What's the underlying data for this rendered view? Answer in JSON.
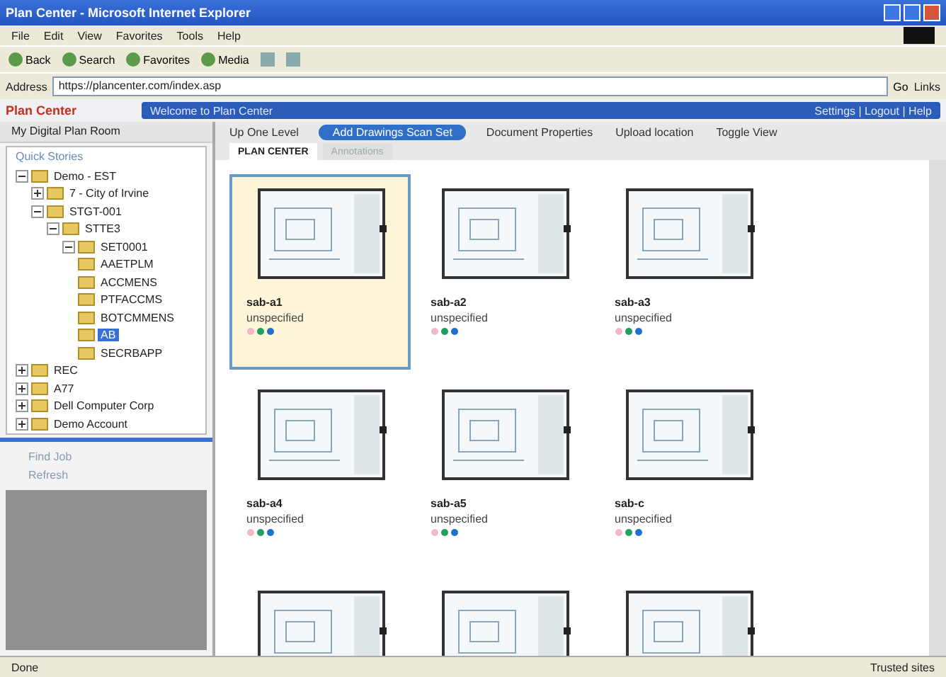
{
  "window": {
    "title": "Plan Center - Microsoft Internet Explorer"
  },
  "menu": [
    "File",
    "Edit",
    "View",
    "Favorites",
    "Tools",
    "Help"
  ],
  "toolbar": [
    {
      "label": "Back"
    },
    {
      "label": "Search"
    },
    {
      "label": "Favorites"
    },
    {
      "label": "Media"
    }
  ],
  "address": {
    "label": "Address",
    "value": "https://plancenter.com/index.asp",
    "go": "Go",
    "links": "Links"
  },
  "app_header": {
    "brand": "Plan Center",
    "nav": "Welcome to Plan Center",
    "right": "Settings | Logout | Help"
  },
  "sidebar": {
    "title": "My Digital Plan Room",
    "section": "Quick Stories",
    "tree": [
      {
        "label": "Demo - EST",
        "expanded": true,
        "selected": false,
        "children": [
          {
            "label": "7 - City of Irvine",
            "expanded": false,
            "selected": false
          },
          {
            "label": "STGT-001",
            "expanded": true,
            "selected": false,
            "children": [
              {
                "label": "STTE3",
                "expanded": true,
                "selected": false,
                "children": [
                  {
                    "label": "SET0001",
                    "expanded": true,
                    "selected": false,
                    "children": [
                      {
                        "label": "AAETPLM",
                        "selected": false
                      },
                      {
                        "label": "ACCMENS",
                        "selected": false
                      },
                      {
                        "label": "PTFACCMS",
                        "selected": false
                      },
                      {
                        "label": "BOTCMMENS",
                        "selected": false
                      },
                      {
                        "label": "AB",
                        "selected": true
                      },
                      {
                        "label": "SECRBAPP",
                        "selected": false
                      }
                    ]
                  }
                ]
              }
            ]
          }
        ]
      },
      {
        "label": "REC",
        "expanded": false,
        "selected": false
      },
      {
        "label": "A77",
        "expanded": false,
        "selected": false
      },
      {
        "label": "Dell Computer Corp",
        "expanded": false,
        "selected": false
      },
      {
        "label": "Demo Account",
        "expanded": false,
        "selected": false
      }
    ],
    "links": [
      "Find Job",
      "Refresh"
    ]
  },
  "actions": [
    {
      "label": "Up One Level",
      "kind": "plain"
    },
    {
      "label": "Add Drawings Scan Set",
      "kind": "pill"
    },
    {
      "label": "Document Properties",
      "kind": "plain"
    },
    {
      "label": "Upload location",
      "kind": "plain"
    },
    {
      "label": "Toggle View",
      "kind": "plain"
    }
  ],
  "tabs": [
    {
      "label": "PLAN CENTER",
      "selected": true
    },
    {
      "label": "Annotations",
      "selected": false
    }
  ],
  "sheets": [
    {
      "name": "sab-a1",
      "status": "unspecified",
      "selected": true
    },
    {
      "name": "sab-a2",
      "status": "unspecified",
      "selected": false
    },
    {
      "name": "sab-a3",
      "status": "unspecified",
      "selected": false
    },
    {
      "name": "sab-a4",
      "status": "unspecified",
      "selected": false
    },
    {
      "name": "sab-a5",
      "status": "unspecified",
      "selected": false
    },
    {
      "name": "sab-c",
      "status": "unspecified",
      "selected": false
    },
    {
      "selected": false
    },
    {
      "selected": false
    },
    {
      "selected": false
    }
  ],
  "status_bar": {
    "left": "Done",
    "right": "Trusted sites"
  }
}
